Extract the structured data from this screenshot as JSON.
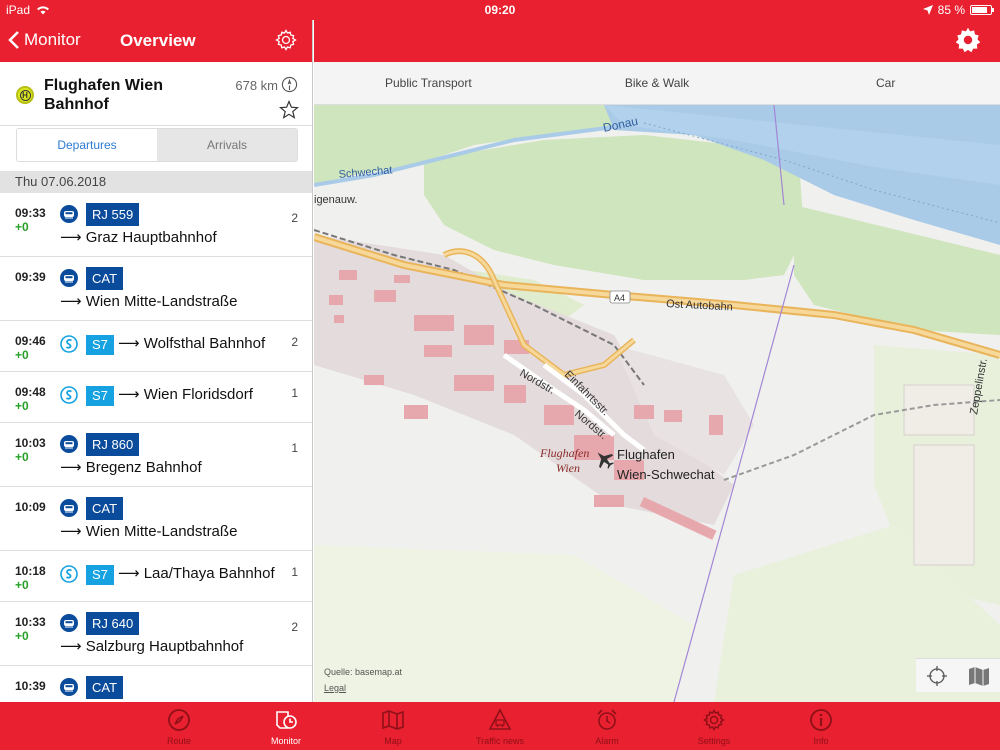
{
  "status_bar": {
    "device": "iPad",
    "time": "09:20",
    "battery": "85 %",
    "battery_level": 0.85
  },
  "left_nav": {
    "back_label": "Monitor",
    "title": "Overview"
  },
  "station": {
    "name": "Flughafen Wien Bahnhof",
    "distance": "678 km"
  },
  "segments": {
    "departures": "Departures",
    "arrivals": "Arrivals"
  },
  "date": "Thu 07.06.2018",
  "departures": [
    {
      "time": "09:33",
      "delay": "+0",
      "type": "rail",
      "line": "RJ 559",
      "destination": "Graz Hauptbahnhof",
      "platform": "2",
      "layout": "tall"
    },
    {
      "time": "09:39",
      "delay": "",
      "type": "rail",
      "line": "CAT",
      "destination": "Wien Mitte-Landstraße",
      "platform": "",
      "layout": "tall"
    },
    {
      "time": "09:46",
      "delay": "+0",
      "type": "sbahn",
      "line": "S7",
      "destination": "Wolfsthal Bahnhof",
      "platform": "2",
      "layout": "short"
    },
    {
      "time": "09:48",
      "delay": "+0",
      "type": "sbahn",
      "line": "S7",
      "destination": "Wien Floridsdorf",
      "platform": "1",
      "layout": "short"
    },
    {
      "time": "10:03",
      "delay": "+0",
      "type": "rail",
      "line": "RJ 860",
      "destination": "Bregenz Bahnhof",
      "platform": "1",
      "layout": "tall"
    },
    {
      "time": "10:09",
      "delay": "",
      "type": "rail",
      "line": "CAT",
      "destination": "Wien Mitte-Landstraße",
      "platform": "",
      "layout": "tall"
    },
    {
      "time": "10:18",
      "delay": "+0",
      "type": "sbahn",
      "line": "S7",
      "destination": "Laa/Thaya Bahnhof",
      "platform": "1",
      "layout": "short"
    },
    {
      "time": "10:33",
      "delay": "+0",
      "type": "rail",
      "line": "RJ 640",
      "destination": "Salzburg Hauptbahnhof",
      "platform": "2",
      "layout": "tall"
    },
    {
      "time": "10:39",
      "delay": "",
      "type": "rail",
      "line": "CAT",
      "destination": "",
      "platform": "",
      "layout": "tall"
    }
  ],
  "modes": [
    "Public Transport",
    "Bike & Walk",
    "Car"
  ],
  "map": {
    "labels": {
      "donau": "Donau",
      "schwechat": "Schwechat",
      "igenau": "igenauw.",
      "a4": "A4",
      "autobahn": "Ost Autobahn",
      "nordstr1": "Nordstr.",
      "einfahrt": "Einfahrtsstr.",
      "nordstr2": "Nordstr.",
      "flughafen1": "Flughafen",
      "flughafen2": "Wien",
      "airport1": "Flughafen",
      "airport2": "Wien-Schwechat",
      "zeppelin": "Zeppelinstr."
    },
    "source": "Quelle: basemap.at",
    "legal": "Legal"
  },
  "tabs": [
    {
      "label": "Route",
      "icon": "compass-icon",
      "active": false
    },
    {
      "label": "Monitor",
      "icon": "monitor-clock-icon",
      "active": true
    },
    {
      "label": "Map",
      "icon": "map-icon",
      "active": false
    },
    {
      "label": "Traffic news",
      "icon": "traffic-warning-icon",
      "active": false
    },
    {
      "label": "Alarm",
      "icon": "alarm-clock-icon",
      "active": false
    },
    {
      "label": "Settings",
      "icon": "gear-icon",
      "active": false
    },
    {
      "label": "Info",
      "icon": "info-icon",
      "active": false
    }
  ],
  "colors": {
    "brand_red": "#e8202f",
    "rail_blue": "#0a4b9b",
    "sbahn_blue": "#16a2e0",
    "delay_green": "#28a028",
    "segment_active": "#2d7bd4"
  }
}
